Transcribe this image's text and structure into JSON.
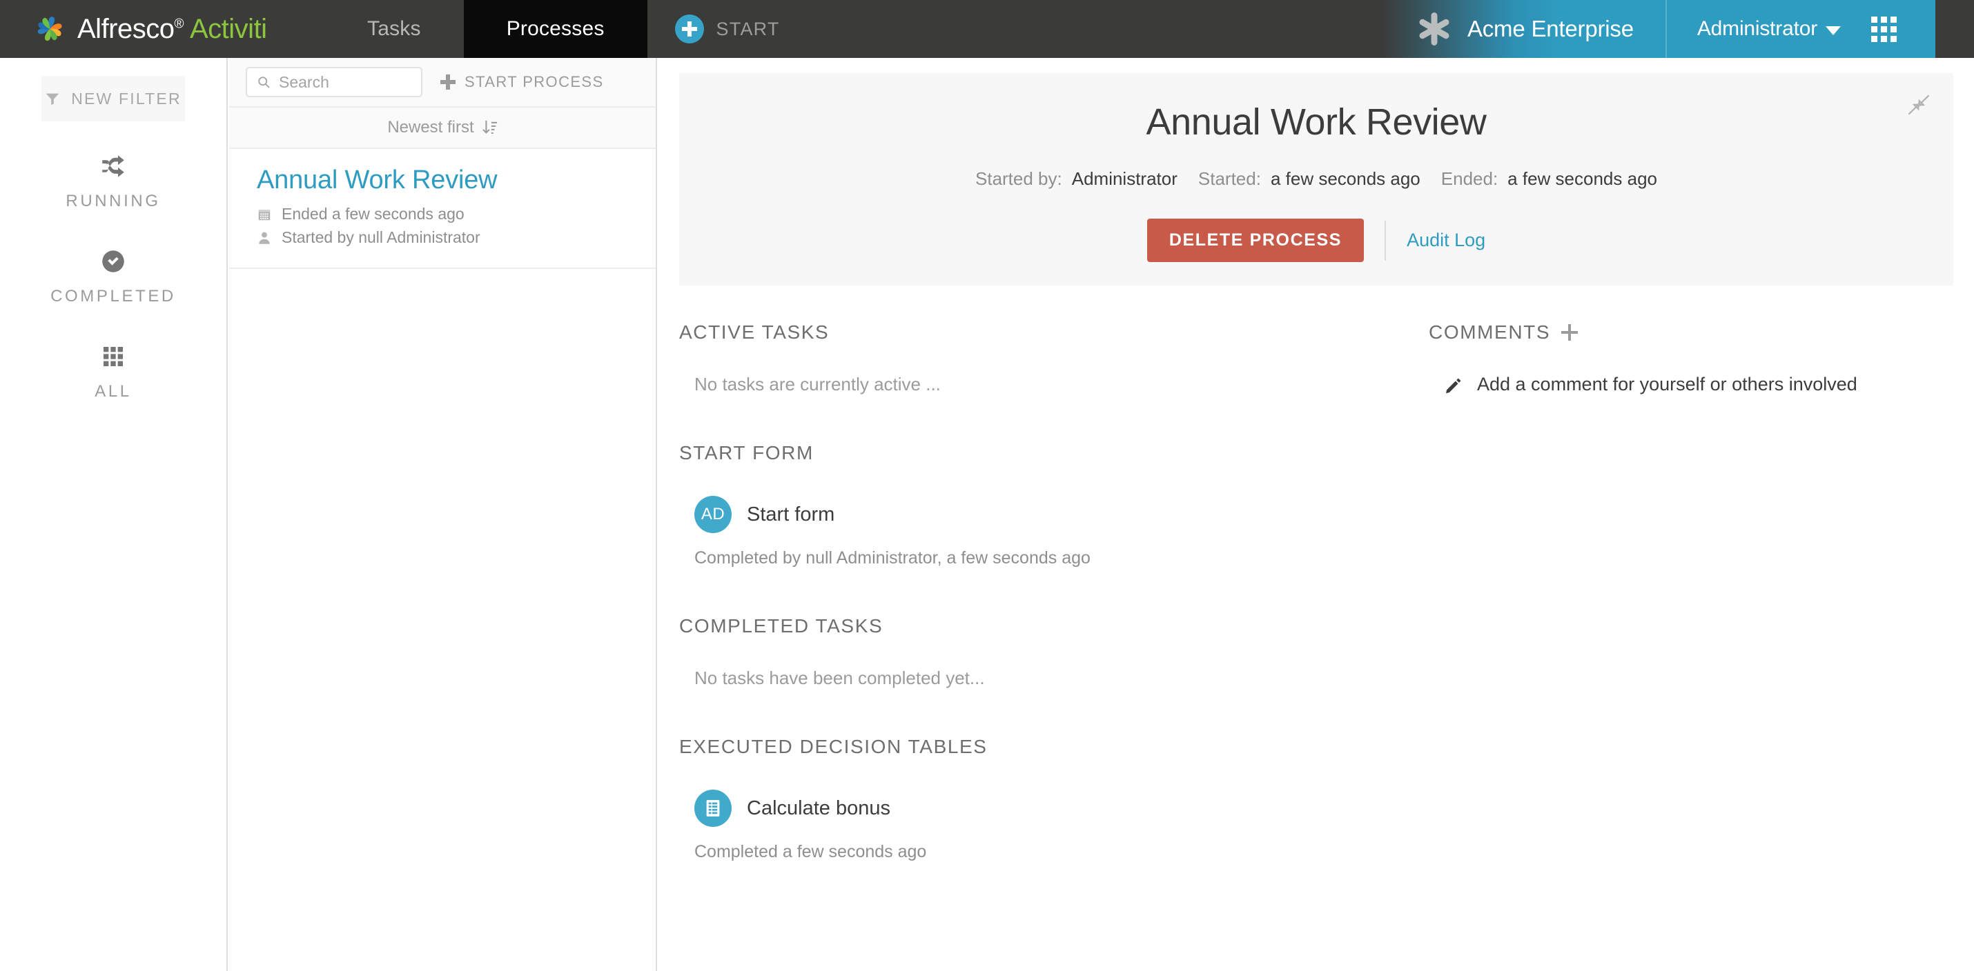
{
  "topbar": {
    "brand": {
      "primary": "Alfresco",
      "registered": "®",
      "secondary": "Activiti"
    },
    "tabs": [
      {
        "label": "Tasks",
        "active": false
      },
      {
        "label": "Processes",
        "active": true
      }
    ],
    "start_label": "START",
    "tenant_name": "Acme Enterprise",
    "user_name": "Administrator",
    "icons": {
      "plus": "plus-circle-icon",
      "tenant": "asterisk-icon",
      "apps": "apps-grid-icon",
      "caret": "chevron-down-icon"
    },
    "colors": {
      "bar": "#3b3b39",
      "active_tab": "#0a0a0a",
      "teal": "#2e9cc0",
      "green": "#8cc63e"
    }
  },
  "rail": {
    "new_filter_label": "NEW FILTER",
    "items": [
      {
        "label": "RUNNING",
        "icon": "shuffle-icon"
      },
      {
        "label": "COMPLETED",
        "icon": "check-circle-icon"
      },
      {
        "label": "ALL",
        "icon": "grid-icon"
      }
    ]
  },
  "list_panel": {
    "search_placeholder": "Search",
    "search_value": "",
    "start_process_label": "START PROCESS",
    "sort_label": "Newest first",
    "items": [
      {
        "title": "Annual Work Review",
        "ended": "Ended a few seconds ago",
        "started_by": "Started by null Administrator"
      }
    ]
  },
  "detail": {
    "title": "Annual Work Review",
    "meta": {
      "started_by_label": "Started by:",
      "started_by_value": "Administrator",
      "started_label": "Started:",
      "started_value": "a few seconds ago",
      "ended_label": "Ended:",
      "ended_value": "a few seconds ago"
    },
    "delete_label": "DELETE PROCESS",
    "audit_label": "Audit Log",
    "collapse_icon": "collapse-icon",
    "sections": {
      "active_tasks": {
        "heading": "ACTIVE TASKS",
        "empty": "No tasks are currently active ..."
      },
      "start_form": {
        "heading": "START FORM",
        "avatar_initials": "AD",
        "name": "Start form",
        "sub": "Completed by null Administrator, a few seconds ago"
      },
      "completed_tasks": {
        "heading": "COMPLETED TASKS",
        "empty": "No tasks have been completed yet..."
      },
      "decision_tables": {
        "heading": "EXECUTED DECISION TABLES",
        "name": "Calculate bonus",
        "sub": "Completed a few seconds ago",
        "icon": "decision-table-icon"
      },
      "comments": {
        "heading": "COMMENTS",
        "add_text": "Add a comment for yourself or others involved",
        "add_icon": "pencil-icon"
      }
    }
  }
}
